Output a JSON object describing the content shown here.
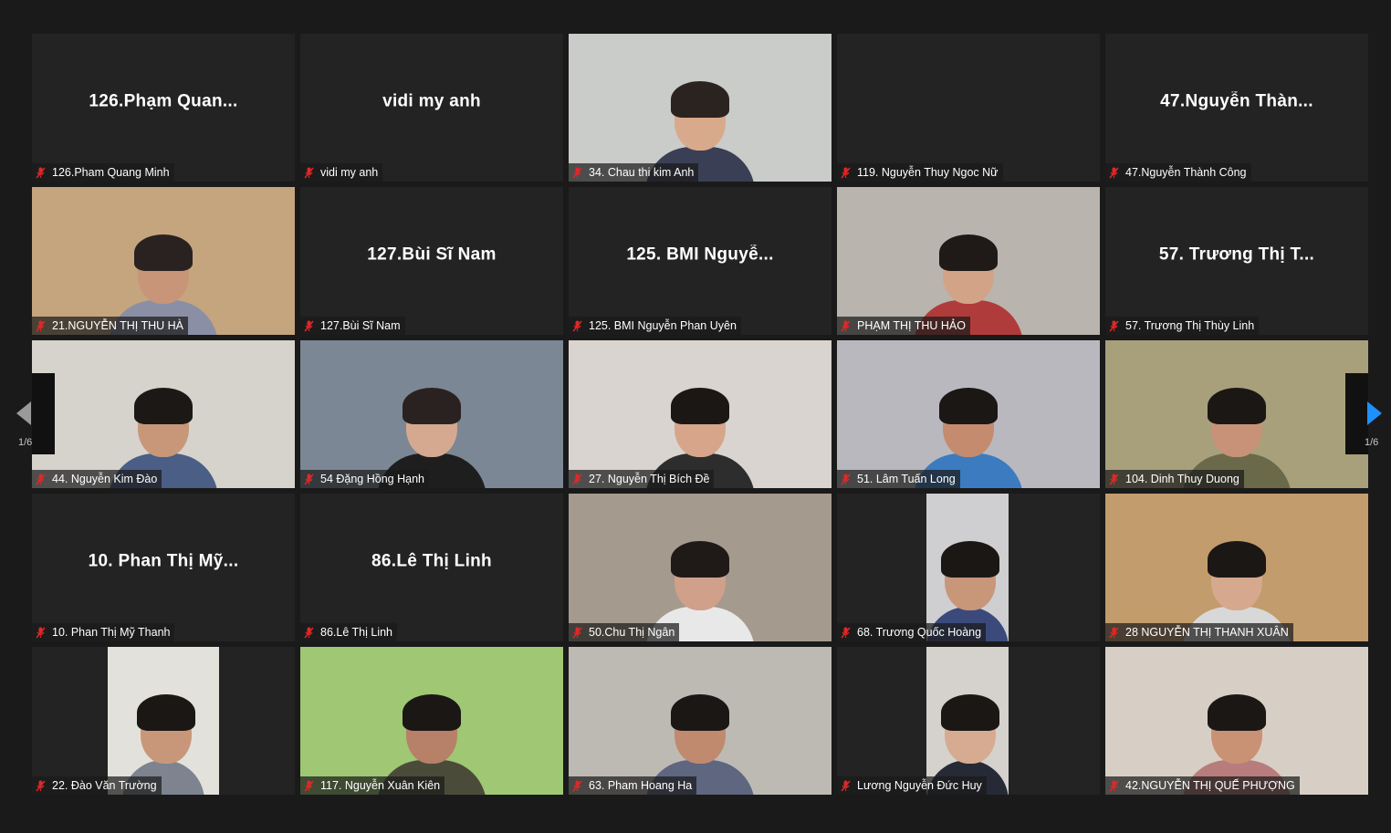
{
  "colors": {
    "background": "#1a1a1a",
    "tile": "#232323",
    "mic_muted": "#e02828",
    "nav_arrow_right": "#1e90ff",
    "nav_arrow_left": "#9a9a9a"
  },
  "navigation": {
    "prev_icon": "chevron-left-icon",
    "next_icon": "chevron-right-icon",
    "page_left": "1/6",
    "page_right": "1/6"
  },
  "participants": [
    {
      "label": "126.Pham Quang Minh",
      "avatar_name": "126.Phạm Quan...",
      "video": false
    },
    {
      "label": "vidi my anh",
      "avatar_name": "vidi my anh",
      "video": false
    },
    {
      "label": "34. Chau thi kim Anh",
      "video": true,
      "bg": "#c9ccc8",
      "skin": "#d9a98c",
      "hair": "#2b2320",
      "shirt": "#3a3f55"
    },
    {
      "label": "119. Nguyễn Thuy Ngoc Nữ",
      "avatar_name": "",
      "video": false
    },
    {
      "label": "47.Nguyễn Thành Công",
      "avatar_name": "47.Nguyễn Thàn...",
      "video": false
    },
    {
      "label": "21.NGUYỄN THỊ THU HÀ",
      "video": true,
      "bg": "#c4a57e",
      "skin": "#c99578",
      "hair": "#2a2220",
      "shirt": "#8a8fa6"
    },
    {
      "label": "127.Bùi Sĩ Nam",
      "avatar_name": "127.Bùi Sĩ Nam",
      "video": false
    },
    {
      "label": "125. BMI Nguyễn Phan Uyên",
      "avatar_name": "125. BMI Nguyễ...",
      "video": false
    },
    {
      "label": "PHẠM THỊ THU HẢO",
      "video": true,
      "bg": "#b9b4ad",
      "skin": "#d3a387",
      "hair": "#1f1a18",
      "shirt": "#b03b3b"
    },
    {
      "label": "57. Trương Thị Thùy Linh",
      "avatar_name": "57. Trương Thị T...",
      "video": false
    },
    {
      "label": "44. Nguyễn Kim Đào",
      "video": true,
      "bg": "#d6d2cc",
      "skin": "#c8977a",
      "hair": "#1c1816",
      "shirt": "#4a5e86"
    },
    {
      "label": "54 Đặng Hồng Hạnh",
      "video": true,
      "bg": "#7b8794",
      "skin": "#d4a98f",
      "hair": "#2a2220",
      "shirt": "#1e1e1e"
    },
    {
      "label": "27. Nguyễn Thị Bích Đề",
      "video": true,
      "bg": "#d9d4cf",
      "skin": "#d6a58a",
      "hair": "#1b1715",
      "shirt": "#2d2d2d"
    },
    {
      "label": "51. Lâm Tuấn Long",
      "video": true,
      "bg": "#b9b8bf",
      "skin": "#c58b6f",
      "hair": "#1b1715",
      "shirt": "#3c7bbf"
    },
    {
      "label": "104. Dinh Thuy Duong",
      "video": true,
      "bg": "#a8a07a",
      "skin": "#c79277",
      "hair": "#1b1715",
      "shirt": "#6a6a4a"
    },
    {
      "label": "10. Phan Thị Mỹ Thanh",
      "avatar_name": "10. Phan Thị Mỹ...",
      "video": false
    },
    {
      "label": "86.Lê Thị Linh",
      "avatar_name": "86.Lê Thị Linh",
      "video": false
    },
    {
      "label": "50.Chu Thị Ngân",
      "video": true,
      "bg": "#a59a8e",
      "skin": "#d1a08a",
      "hair": "#1f1a18",
      "shirt": "#e8e8e8"
    },
    {
      "label": "68. Trương Quốc Hoàng",
      "video": true,
      "bg": "#cfcfd1",
      "skin": "#c8977a",
      "hair": "#1b1715",
      "shirt": "#3b4a7a",
      "narrow": true
    },
    {
      "label": "28 NGUYỄN THỊ THANH XUÂN",
      "video": true,
      "bg": "#c29c6c",
      "skin": "#d6a88d",
      "hair": "#1b1715",
      "shirt": "#d8d8d8"
    },
    {
      "label": "22. Đào Văn Trường",
      "video": true,
      "bg": "#e3e1dc",
      "skin": "#c8977a",
      "hair": "#1b1715",
      "shirt": "#7d8490",
      "narrow": true
    },
    {
      "label": "117. Nguyễn Xuân Kiên",
      "video": true,
      "bg": "#9fc774",
      "skin": "#b78068",
      "hair": "#1b1715",
      "shirt": "#4b4b3a"
    },
    {
      "label": "63. Pham Hoang Ha",
      "video": true,
      "bg": "#bdbab4",
      "skin": "#c08a6e",
      "hair": "#1b1715",
      "shirt": "#5e6680"
    },
    {
      "label": "Lương Nguyễn Đức Huy",
      "video": true,
      "bg": "#d5d2cd",
      "skin": "#d7ab91",
      "hair": "#1b1715",
      "shirt": "#262a36",
      "narrow": true
    },
    {
      "label": "42.NGUYỄN THỊ QUẾ PHƯỢNG",
      "video": true,
      "bg": "#d7cfc5",
      "skin": "#c99274",
      "hair": "#1b1715",
      "shirt": "#b87c7c"
    }
  ]
}
